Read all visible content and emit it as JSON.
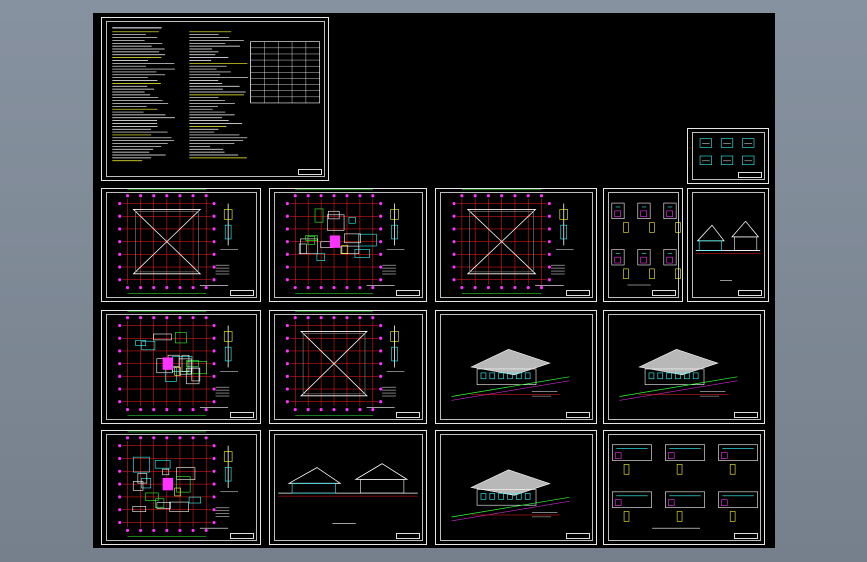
{
  "viewport": {
    "background": "#7f8a96",
    "model_space_background": "#000000"
  },
  "drawing_sheets": [
    {
      "id": "cover-notes",
      "kind": "notes"
    },
    {
      "id": "detail-legend",
      "kind": "legend"
    },
    {
      "id": "plan-a",
      "kind": "plan"
    },
    {
      "id": "plan-b",
      "kind": "plan"
    },
    {
      "id": "plan-c",
      "kind": "plan"
    },
    {
      "id": "details-1",
      "kind": "details"
    },
    {
      "id": "section-1",
      "kind": "section"
    },
    {
      "id": "plan-d",
      "kind": "plan"
    },
    {
      "id": "plan-e",
      "kind": "plan"
    },
    {
      "id": "elevation-1",
      "kind": "elevation"
    },
    {
      "id": "elevation-2",
      "kind": "elevation"
    },
    {
      "id": "plan-f",
      "kind": "plan"
    },
    {
      "id": "section-2",
      "kind": "section"
    },
    {
      "id": "elevation-3",
      "kind": "elevation"
    },
    {
      "id": "details-2",
      "kind": "details"
    }
  ],
  "colors": {
    "white": "#ffffff",
    "red": "#ff2020",
    "magenta": "#ff33ff",
    "yellow": "#ffff33",
    "cyan": "#33ffff",
    "green": "#33ff33",
    "blue": "#4060ff",
    "gray": "#8a8a8a"
  }
}
